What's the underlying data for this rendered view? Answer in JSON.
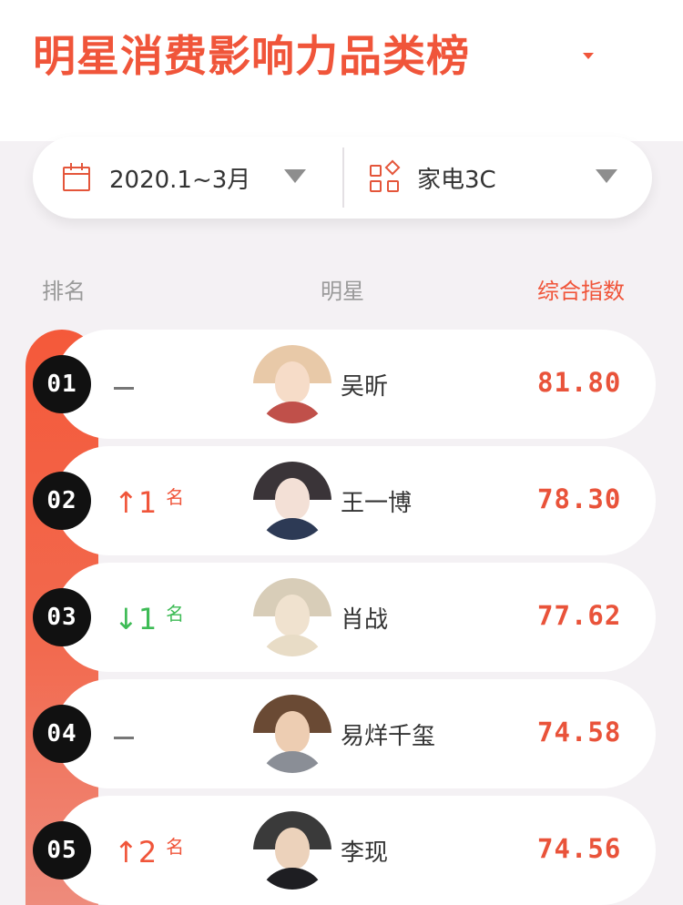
{
  "title": "明星消费影响力品类榜",
  "filters": {
    "date": {
      "value": "2020.1~3月",
      "icon": "calendar-icon"
    },
    "category": {
      "value": "家电3C",
      "icon": "category-grid-icon"
    }
  },
  "columns": {
    "rank": "排名",
    "star": "明星",
    "score": "综合指数"
  },
  "colors": {
    "accent": "#f0553a",
    "up": "#f0553a",
    "down": "#3dbb55"
  },
  "rows": [
    {
      "rank": "01",
      "change": {
        "dir": "none",
        "num": "",
        "unit": ""
      },
      "name": "吴昕",
      "score": "81.80"
    },
    {
      "rank": "02",
      "change": {
        "dir": "up",
        "arrow": "↑",
        "num": "1",
        "unit": "名"
      },
      "name": "王一博",
      "score": "78.30"
    },
    {
      "rank": "03",
      "change": {
        "dir": "down",
        "arrow": "↓",
        "num": "1",
        "unit": "名"
      },
      "name": "肖战",
      "score": "77.62"
    },
    {
      "rank": "04",
      "change": {
        "dir": "none",
        "num": "",
        "unit": ""
      },
      "name": "易烊千玺",
      "score": "74.58"
    },
    {
      "rank": "05",
      "change": {
        "dir": "up",
        "arrow": "↑",
        "num": "2",
        "unit": "名"
      },
      "name": "李现",
      "score": "74.56"
    }
  ]
}
